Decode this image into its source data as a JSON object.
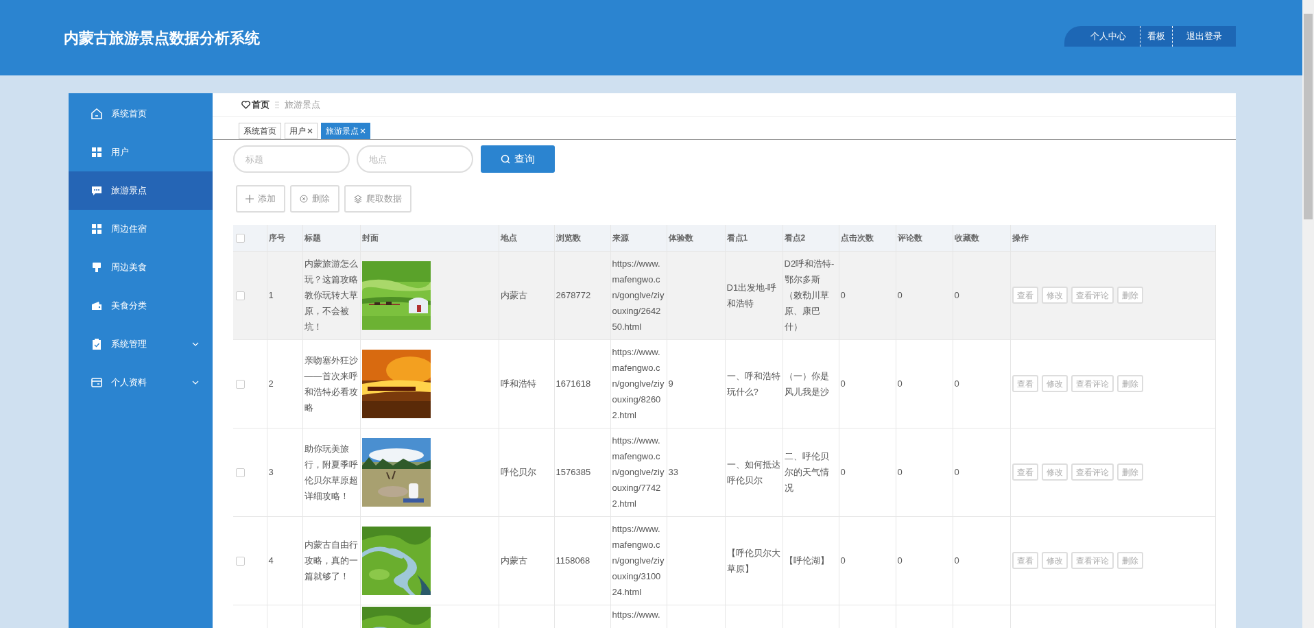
{
  "header": {
    "title": "内蒙古旅游景点数据分析系统",
    "nav": [
      "个人中心",
      "看板",
      "退出登录"
    ]
  },
  "sidebar": {
    "items": [
      {
        "label": "系统首页",
        "kind": "home",
        "selected": false,
        "expandable": false
      },
      {
        "label": "用户",
        "kind": "grid",
        "selected": false,
        "expandable": false
      },
      {
        "label": "旅游景点",
        "kind": "chat",
        "selected": true,
        "expandable": false
      },
      {
        "label": "周边住宿",
        "kind": "grid",
        "selected": false,
        "expandable": false
      },
      {
        "label": "周边美食",
        "kind": "brush",
        "selected": false,
        "expandable": false
      },
      {
        "label": "美食分类",
        "kind": "wallet",
        "selected": false,
        "expandable": false
      },
      {
        "label": "系统管理",
        "kind": "clipboard",
        "selected": false,
        "expandable": true
      },
      {
        "label": "个人资料",
        "kind": "card",
        "selected": false,
        "expandable": true
      }
    ]
  },
  "breadcrumb": [
    "首页",
    "旅游景点"
  ],
  "tabs": [
    {
      "label": "系统首页",
      "selected": false,
      "closable": false
    },
    {
      "label": "用户",
      "selected": false,
      "closable": true
    },
    {
      "label": "旅游景点",
      "selected": true,
      "closable": true
    }
  ],
  "search": {
    "fields": [
      {
        "placeholder": "标题"
      },
      {
        "placeholder": "地点"
      }
    ],
    "button": "查询"
  },
  "actions": [
    {
      "label": "添加",
      "kind": "add"
    },
    {
      "label": "删除",
      "kind": "delete"
    },
    {
      "label": "爬取数据",
      "kind": "crawl"
    }
  ],
  "table": {
    "columns": [
      "序号",
      "标题",
      "封面",
      "地点",
      "浏览数",
      "来源",
      "体验数",
      "看点1",
      "看点2",
      "点击次数",
      "评论数",
      "收藏数",
      "操作"
    ],
    "header_checked": false,
    "rows": [
      {
        "checked": false,
        "hovered": true,
        "index": "1",
        "title": "内蒙旅游怎么玩？这篇攻略教你玩转大草原，不会被坑！",
        "cover": {
          "kind": "picture"
        },
        "place": "内蒙古",
        "views": "2678772",
        "source": "https://www.mafengwo.cn/gonglve/ziyouxing/264250.html",
        "highlight1": "D1出发地-呼和浩特",
        "highlight2": "D2呼和浩特-鄂尔多斯（敕勒川草原、康巴什）",
        "clicks": "0",
        "comments": "0",
        "favorites": "0",
        "actions": [
          "查看",
          "修改",
          "查看评论",
          "删除"
        ]
      },
      {
        "checked": false,
        "hovered": false,
        "index": "2",
        "title": "亲吻塞外狂沙——首次来呼和浩特必看攻略",
        "cover": {
          "kind": "picture"
        },
        "place": "呼和浩特",
        "views": "1671618",
        "source": "https://www.mafengwo.cn/gonglve/ziyouxing/82602.html",
        "experiences": "9",
        "highlight1": "一、呼和浩特玩什么?",
        "highlight2": "（一）你是风儿我是沙",
        "clicks": "0",
        "comments": "0",
        "favorites": "0",
        "actions": [
          "查看",
          "修改",
          "查看评论",
          "删除"
        ]
      },
      {
        "checked": false,
        "hovered": false,
        "index": "3",
        "title": "助你玩美旅行，附夏季呼伦贝尔草原超详细攻略！",
        "cover": {
          "kind": "picture"
        },
        "place": "呼伦贝尔",
        "views": "1576385",
        "source": "https://www.mafengwo.cn/gonglve/ziyouxing/77422.html",
        "experiences": "33",
        "highlight1": "一、如何抵达呼伦贝尔",
        "highlight2": "二、呼伦贝尔的天气情况",
        "clicks": "0",
        "comments": "0",
        "favorites": "0",
        "actions": [
          "查看",
          "修改",
          "查看评论",
          "删除"
        ]
      },
      {
        "checked": false,
        "hovered": false,
        "index": "4",
        "title": "内蒙古自由行攻略，真的一篇就够了！",
        "cover": {
          "kind": "picture"
        },
        "place": "内蒙古",
        "views": "1158068",
        "source": "https://www.mafengwo.cn/gonglve/ziyouxing/310024.html",
        "highlight1": "【呼伦贝尔大草原】",
        "highlight2": "【呼伦湖】",
        "clicks": "0",
        "comments": "0",
        "favorites": "0",
        "actions": [
          "查看",
          "修改",
          "查看评论",
          "删除"
        ]
      },
      {
        "cover": {
          "kind": "picture"
        },
        "source": "https://www."
      }
    ]
  }
}
